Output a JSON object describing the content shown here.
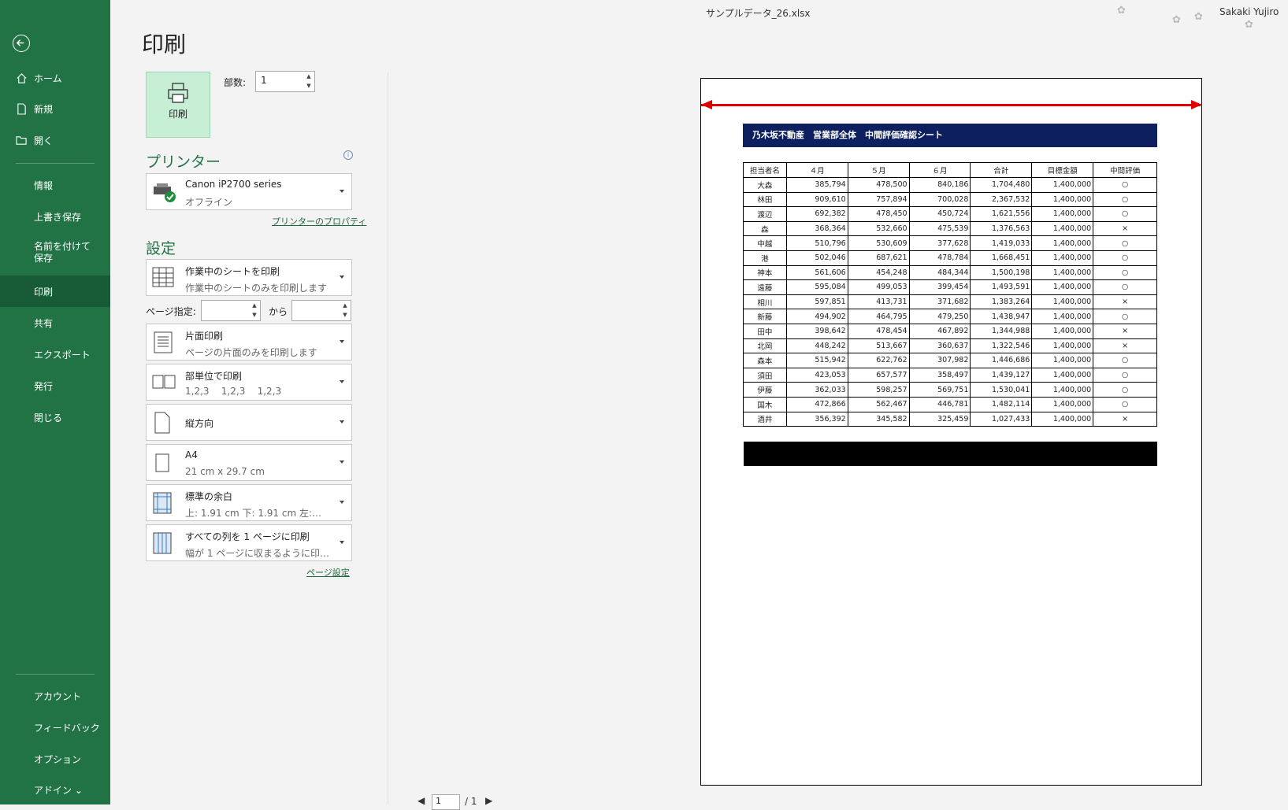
{
  "window": {
    "filename": "サンプルデータ_26.xlsx",
    "user": "Sakaki Yujiro"
  },
  "sidebar": {
    "items": [
      {
        "label": "ホーム",
        "icon": "home-icon"
      },
      {
        "label": "新規",
        "icon": "new-file-icon"
      },
      {
        "label": "開く",
        "icon": "folder-open-icon"
      },
      {
        "label": "情報"
      },
      {
        "label": "上書き保存"
      },
      {
        "label": "名前を付けて保存"
      },
      {
        "label": "印刷"
      },
      {
        "label": "共有"
      },
      {
        "label": "エクスポート"
      },
      {
        "label": "発行"
      },
      {
        "label": "閉じる"
      },
      {
        "label": "アカウント"
      },
      {
        "label": "フィードバック"
      },
      {
        "label": "オプション"
      },
      {
        "label": "アドイン ⌄"
      }
    ],
    "active": "印刷"
  },
  "print": {
    "heading": "印刷",
    "print_button_label": "印刷",
    "copies_label": "部数:",
    "copies_value": "1",
    "printer_heading": "プリンター",
    "printer_name": "Canon iP2700 series",
    "printer_status": "オフライン",
    "printer_properties_link": "プリンターのプロパティ",
    "settings_heading": "設定",
    "settings": [
      {
        "main": "作業中のシートを印刷",
        "sub": "作業中のシートのみを印刷します"
      },
      {
        "main": "片面印刷",
        "sub": "ページの片面のみを印刷します"
      },
      {
        "main": "部単位で印刷",
        "sub": "1,2,3    1,2,3    1,2,3"
      },
      {
        "main": "縦方向"
      },
      {
        "main": "A4",
        "sub": "21 cm x 29.7 cm"
      },
      {
        "main": "標準の余白",
        "sub": "上: 1.91 cm 下: 1.91 cm 左:…"
      },
      {
        "main": "すべての列を 1 ページに印刷",
        "sub": "幅が 1 ページに収まるように印刷…"
      }
    ],
    "page_range_label": "ページ指定:",
    "page_range_to": "から",
    "page_setup_link": "ページ設定"
  },
  "preview": {
    "report_title": "乃木坂不動産　営業部全体　中間評価確認シート",
    "columns": [
      "担当者名",
      "４月",
      "５月",
      "６月",
      "合計",
      "目標金額",
      "中間評価"
    ],
    "rows": [
      [
        "大森",
        "385,794",
        "478,500",
        "840,186",
        "1,704,480",
        "1,400,000",
        "○"
      ],
      [
        "林田",
        "909,610",
        "757,894",
        "700,028",
        "2,367,532",
        "1,400,000",
        "○"
      ],
      [
        "渡辺",
        "692,382",
        "478,450",
        "450,724",
        "1,621,556",
        "1,400,000",
        "○"
      ],
      [
        "森",
        "368,364",
        "532,660",
        "475,539",
        "1,376,563",
        "1,400,000",
        "×"
      ],
      [
        "中越",
        "510,796",
        "530,609",
        "377,628",
        "1,419,033",
        "1,400,000",
        "○"
      ],
      [
        "港",
        "502,046",
        "687,621",
        "478,784",
        "1,668,451",
        "1,400,000",
        "○"
      ],
      [
        "神本",
        "561,606",
        "454,248",
        "484,344",
        "1,500,198",
        "1,400,000",
        "○"
      ],
      [
        "遠藤",
        "595,084",
        "499,053",
        "399,454",
        "1,493,591",
        "1,400,000",
        "○"
      ],
      [
        "相川",
        "597,851",
        "413,731",
        "371,682",
        "1,383,264",
        "1,400,000",
        "×"
      ],
      [
        "新藤",
        "494,902",
        "464,795",
        "479,250",
        "1,438,947",
        "1,400,000",
        "○"
      ],
      [
        "田中",
        "398,642",
        "478,454",
        "467,892",
        "1,344,988",
        "1,400,000",
        "×"
      ],
      [
        "北岡",
        "448,242",
        "513,667",
        "360,637",
        "1,322,546",
        "1,400,000",
        "×"
      ],
      [
        "森本",
        "515,942",
        "622,762",
        "307,982",
        "1,446,686",
        "1,400,000",
        "○"
      ],
      [
        "須田",
        "423,053",
        "657,577",
        "358,497",
        "1,439,127",
        "1,400,000",
        "○"
      ],
      [
        "伊藤",
        "362,033",
        "598,257",
        "569,751",
        "1,530,041",
        "1,400,000",
        "○"
      ],
      [
        "国木",
        "472,866",
        "562,467",
        "446,781",
        "1,482,114",
        "1,400,000",
        "○"
      ],
      [
        "酒井",
        "356,392",
        "345,582",
        "325,459",
        "1,027,433",
        "1,400,000",
        "×"
      ]
    ],
    "page_current": "1",
    "page_total": "/ 1"
  },
  "colors": {
    "brand": "#217346",
    "sidebar_active": "#185c37",
    "report_header": "#0d1f5f",
    "arrow": "#e00000"
  }
}
